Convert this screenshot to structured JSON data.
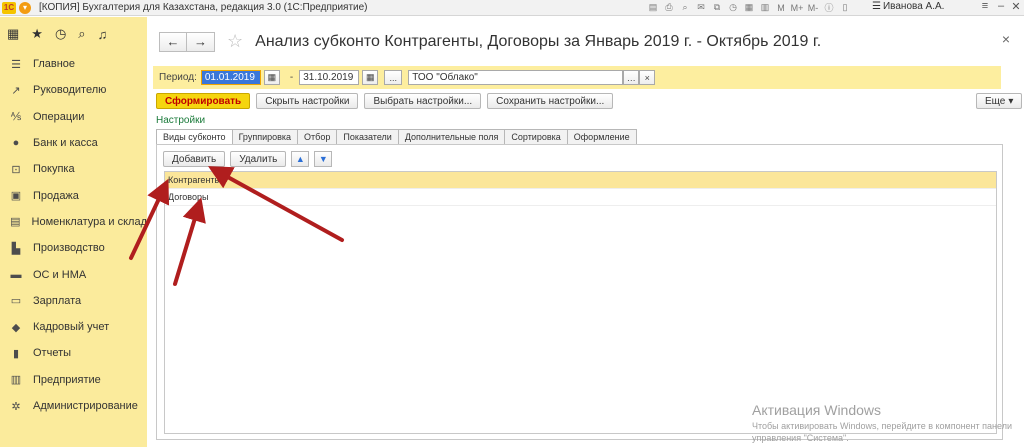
{
  "titlebar": {
    "title": "[КОПИЯ] Бухгалтерия для Казахстана, редакция 3.0  (1С:Предприятие)",
    "user": "Иванова А.А.",
    "tools": [
      "M",
      "M+",
      "M-"
    ]
  },
  "sidebar": {
    "items": [
      {
        "label": "Главное",
        "icon": "menu-icon"
      },
      {
        "label": "Руководителю",
        "icon": "chart-line-icon"
      },
      {
        "label": "Операции",
        "icon": "operations-icon"
      },
      {
        "label": "Банк и касса",
        "icon": "bank-icon"
      },
      {
        "label": "Покупка",
        "icon": "cart-icon"
      },
      {
        "label": "Продажа",
        "icon": "bag-icon"
      },
      {
        "label": "Номенклатура и склад",
        "icon": "warehouse-icon"
      },
      {
        "label": "Производство",
        "icon": "factory-icon"
      },
      {
        "label": "ОС и НМА",
        "icon": "truck-icon"
      },
      {
        "label": "Зарплата",
        "icon": "salary-icon"
      },
      {
        "label": "Кадровый учет",
        "icon": "people-icon"
      },
      {
        "label": "Отчеты",
        "icon": "reports-icon"
      },
      {
        "label": "Предприятие",
        "icon": "enterprise-icon"
      },
      {
        "label": "Администрирование",
        "icon": "gear-icon"
      }
    ]
  },
  "header": {
    "title": "Анализ субконто Контрагенты, Договоры  за Январь 2019 г. - Октябрь 2019 г."
  },
  "period": {
    "label": "Период:",
    "from": "01.01.2019",
    "dash": "-",
    "to": "31.10.2019",
    "dots": "...",
    "org": "ТОО \"Облако\""
  },
  "actions": {
    "generate": "Сформировать",
    "hide_settings": "Скрыть настройки",
    "choose_settings": "Выбрать настройки...",
    "save_settings": "Сохранить настройки...",
    "more": "Еще"
  },
  "settings_link": "Настройки",
  "tabs": [
    "Виды субконто",
    "Группировка",
    "Отбор",
    "Показатели",
    "Дополнительные поля",
    "Сортировка",
    "Оформление"
  ],
  "panel": {
    "add": "Добавить",
    "delete": "Удалить"
  },
  "grid": {
    "rows": [
      "Контрагенты",
      "Договоры"
    ]
  },
  "watermark": {
    "title": "Активация Windows",
    "text": "Чтобы активировать Windows, перейдите в компонент панели управления \"Система\"."
  },
  "colors": {
    "sidebar_bg": "#fbeb9c",
    "primary_button": "#f5d50f",
    "selected_row": "#fbe69a",
    "arrow": "#b01e1e"
  }
}
